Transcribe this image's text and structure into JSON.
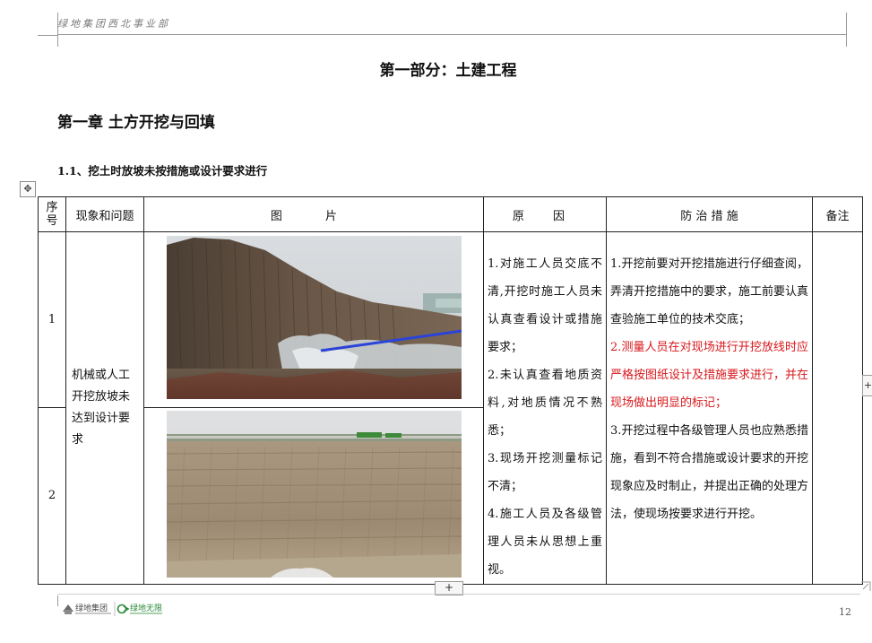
{
  "header": {
    "org_text": "绿地集团西北事业部"
  },
  "page_title": "第一部分：土建工程",
  "chapter_title": "第一章  土方开挖与回填",
  "section_title": "1.1、挖土时放坡未按措施或设计要求进行",
  "table": {
    "headers": {
      "seq": "序号",
      "phenomenon": "现象和问题",
      "photo": "图 片",
      "cause": "原 因",
      "measures": "防 治 措 施",
      "remarks": "备注"
    },
    "rows": [
      {
        "seq": "1"
      },
      {
        "seq": "2"
      }
    ],
    "phenomenon": "机械或人工开挖放坡未达到设计要求",
    "causes": [
      "1.对施工人员交底不清,开挖时施工人员未认真查看设计或措施要求；",
      "2.未认真查看地质资料,对地质情况不熟悉；",
      "3.现场开挖测量标记不清；",
      "4.施工人员及各级管理人员未从思想上重视。"
    ],
    "measures": [
      {
        "text": "1.开挖前要对开挖措施进行仔细查阅，弄清开挖措施中的要求，施工前要认真查验施工单位的技术交底；",
        "highlight": false
      },
      {
        "text": "2.测量人员在对现场进行开挖放线时应严格按图纸设计及措施要求进行，并在现场做出明显的标记；",
        "highlight": true
      },
      {
        "text": "3.开挖过程中各级管理人员也应熟悉措施，看到不符合措施或设计要求的开挖现象应及时制止，并提出正确的处理方法，使现场按要求进行开挖。",
        "highlight": false
      }
    ],
    "remarks": ""
  },
  "footer": {
    "logo_left": "绿地集团",
    "logo_right": "绿地无限",
    "page_number": "12"
  },
  "colors": {
    "highlight_text": "#d8181c",
    "border": "#222222",
    "logo_green": "#2a8a3a"
  },
  "ui": {
    "add_row_icon": "plus-icon",
    "move_icon": "move-cross-icon"
  }
}
